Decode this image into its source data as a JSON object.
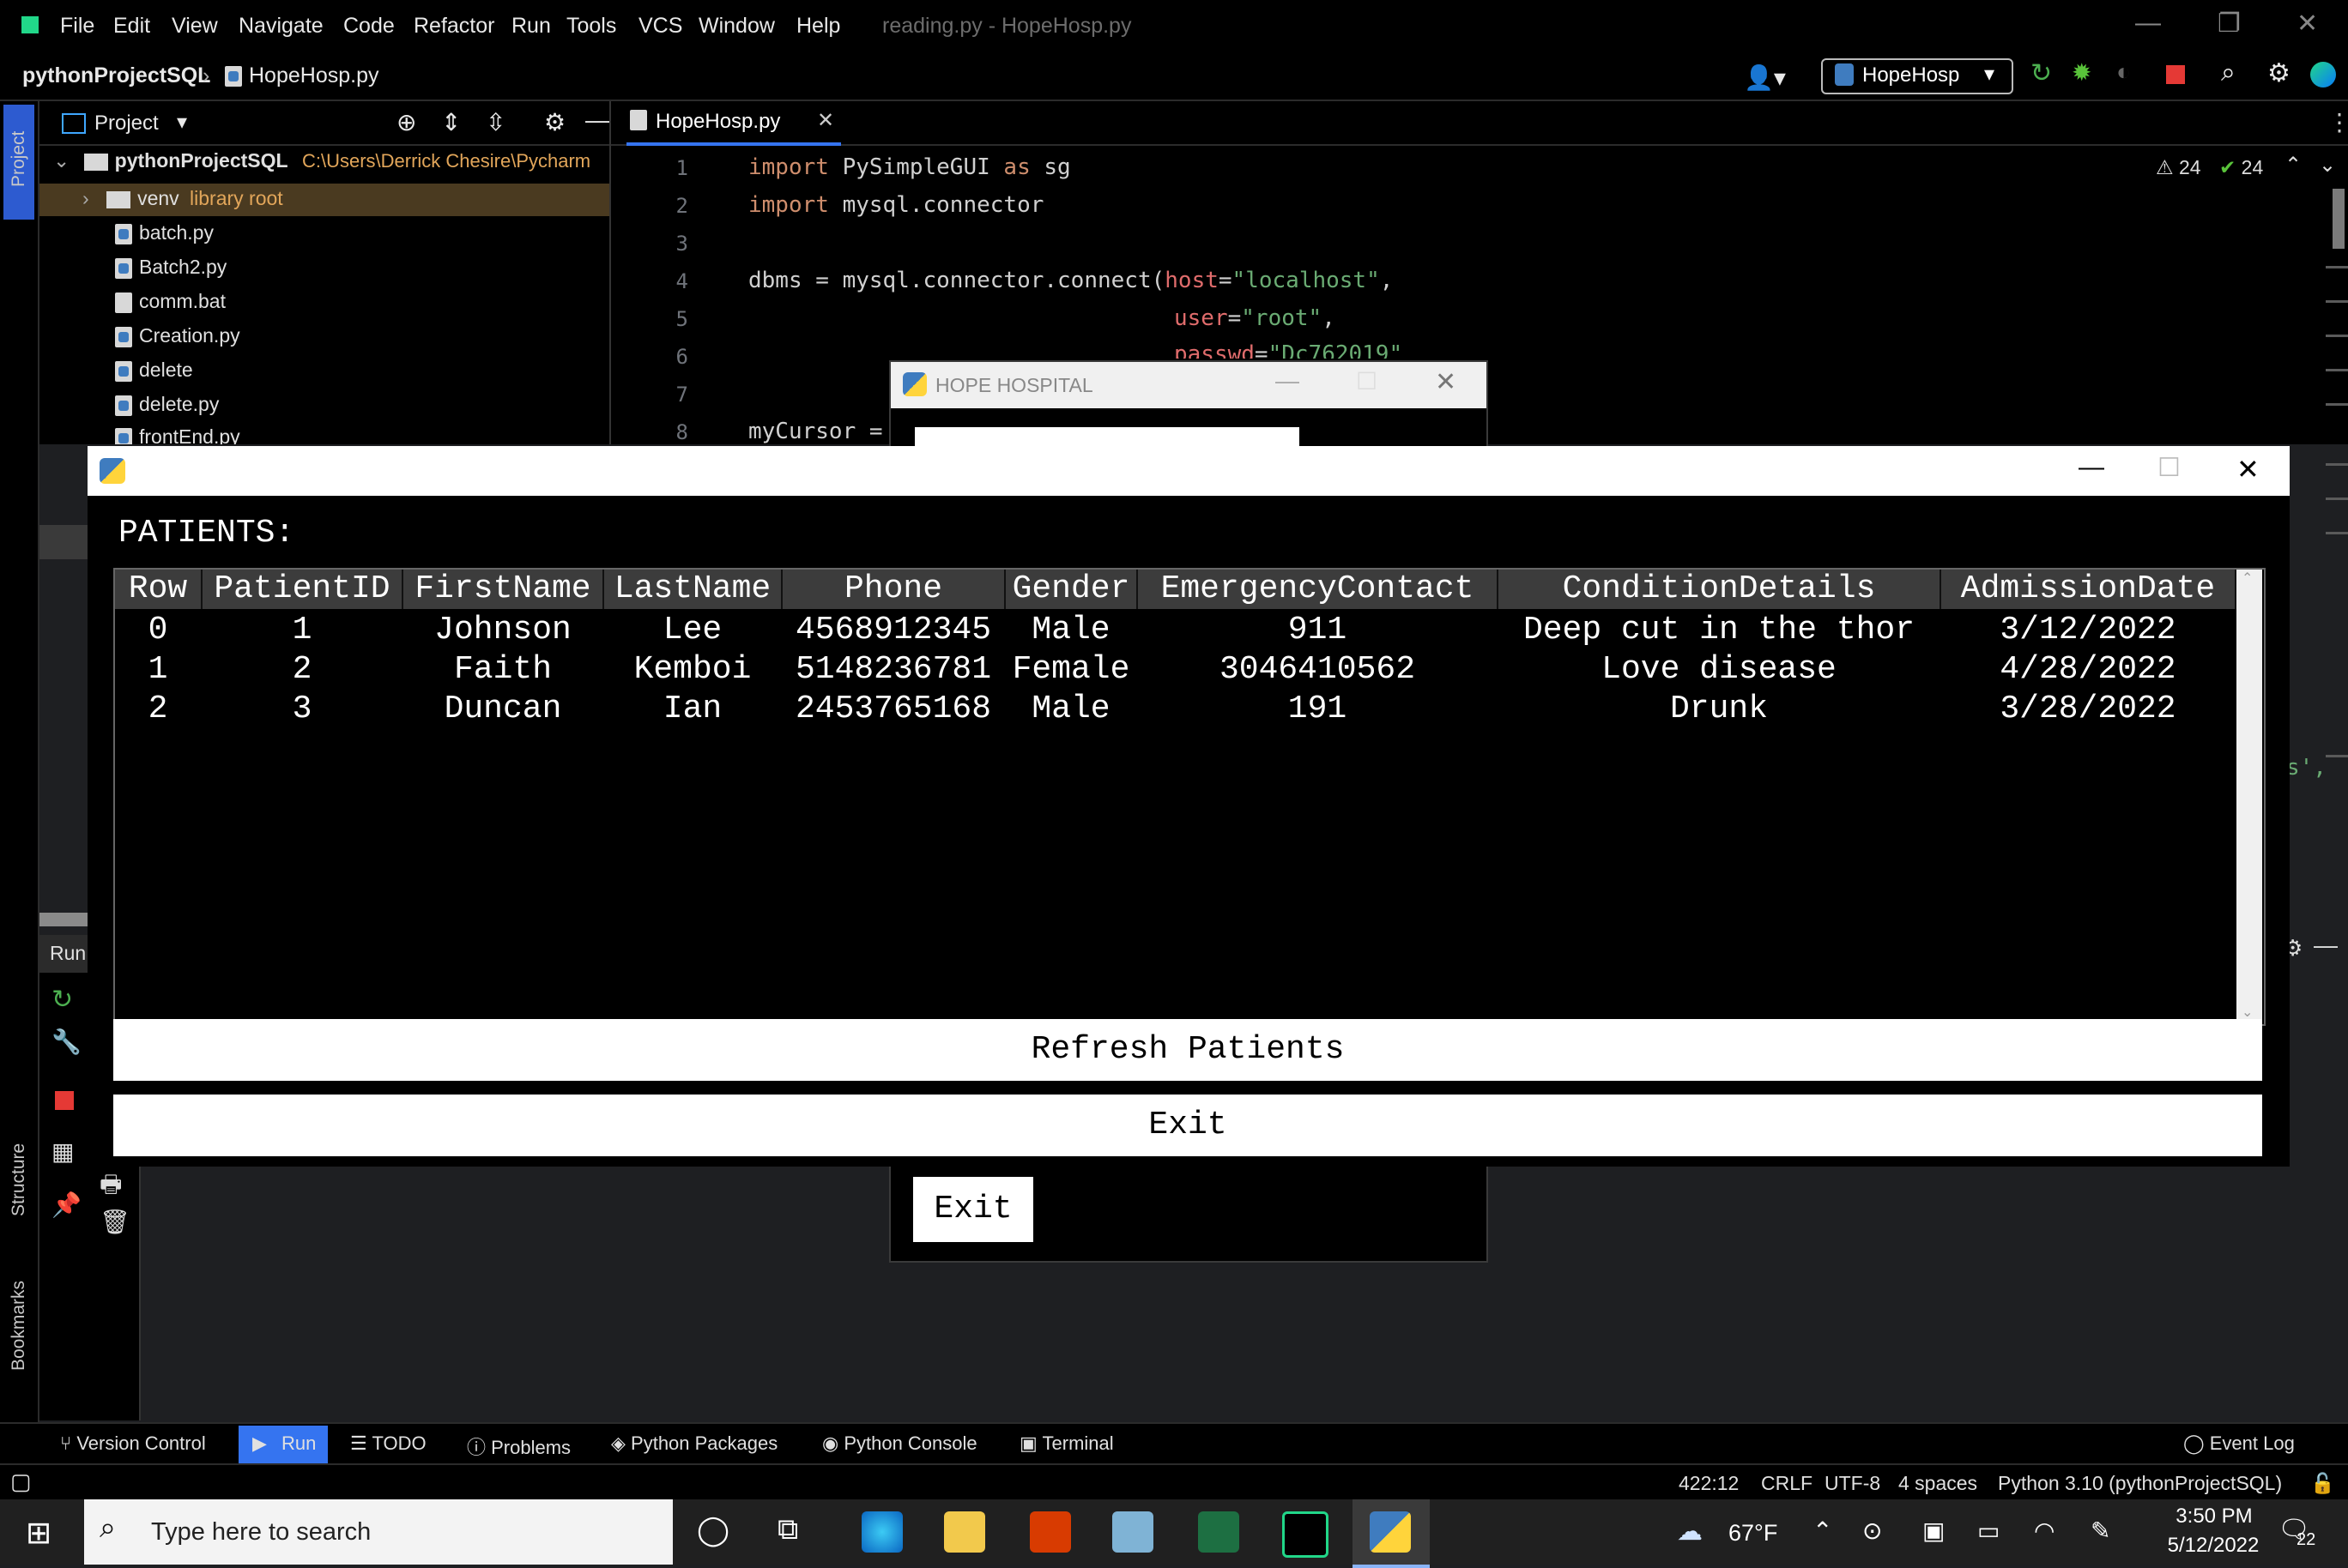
{
  "titlebar": {
    "menus": [
      "File",
      "Edit",
      "View",
      "Navigate",
      "Code",
      "Refactor",
      "Run",
      "Tools",
      "VCS",
      "Window",
      "Help"
    ],
    "window_title": "reading.py - HopeHosp.py"
  },
  "navbar": {
    "project": "pythonProjectSQL",
    "file": "HopeHosp.py",
    "run_config": "HopeHosp"
  },
  "project_panel": {
    "header": "Project",
    "root_name": "pythonProjectSQL",
    "root_path": "C:\\Users\\Derrick Chesire\\Pycharm",
    "venv_name": "venv",
    "venv_note": "library root",
    "files": [
      "batch.py",
      "Batch2.py",
      "comm.bat",
      "Creation.py",
      "delete",
      "delete.py",
      "frontEnd.py"
    ]
  },
  "editor": {
    "tab": "HopeHosp.py",
    "warnings": "24",
    "checks": "24",
    "line_numbers": [
      "1",
      "2",
      "3",
      "4",
      "5",
      "6",
      "7",
      "8"
    ],
    "lines": {
      "l1_kw": "import",
      "l1_rest": " PySimpleGUI ",
      "l1_as": "as",
      "l1_sg": " sg",
      "l2_kw": "import",
      "l2_rest": " mysql.connector",
      "l4_a": "dbms = mysql.connector.connect(",
      "l4_p": "host",
      "l4_eq": "=",
      "l4_s": "\"localhost\"",
      "l4_c": ",",
      "l5_p": "user",
      "l5_eq": "=",
      "l5_s": "\"root\"",
      "l5_c": ",",
      "l6_p": "passwd",
      "l6_eq": "=",
      "l6_s": "\"Dc762019\"",
      "l8": "myCursor ="
    },
    "right_fragment": "s',"
  },
  "run_panel": {
    "label": "Run:"
  },
  "side_labels": {
    "project": "Project",
    "structure": "Structure",
    "bookmarks": "Bookmarks"
  },
  "hope_window": {
    "title": "HOPE HOSPITAL",
    "exit_label": "Exit"
  },
  "patients_window": {
    "heading": "PATIENTS:",
    "columns": [
      "Row",
      "PatientID",
      "FirstName",
      "LastName",
      "Phone",
      "Gender",
      "EmergencyContact",
      "ConditionDetails",
      "AdmissionDate"
    ],
    "rows": [
      [
        "0",
        "1",
        "Johnson",
        "Lee",
        "4568912345",
        "Male",
        "911",
        "Deep cut in the thor",
        "3/12/2022"
      ],
      [
        "1",
        "2",
        "Faith",
        "Kemboi",
        "5148236781",
        "Female",
        "3046410562",
        "Love disease",
        "4/28/2022"
      ],
      [
        "2",
        "3",
        "Duncan",
        "Ian",
        "2453765168",
        "Male",
        "191",
        "Drunk",
        "3/28/2022"
      ]
    ],
    "refresh_label": "Refresh Patients",
    "exit_label": "Exit"
  },
  "bottom_tools": {
    "version_control": "Version Control",
    "run": "Run",
    "todo": "TODO",
    "problems": "Problems",
    "python_packages": "Python Packages",
    "python_console": "Python Console",
    "terminal": "Terminal",
    "event_log": "Event Log"
  },
  "statusbar": {
    "position": "422:12",
    "line_sep": "CRLF",
    "encoding": "UTF-8",
    "indent": "4 spaces",
    "interpreter": "Python 3.10 (pythonProjectSQL)"
  },
  "taskbar": {
    "search_placeholder": "Type here to search",
    "weather": "67°F",
    "time": "3:50 PM",
    "date": "5/12/2022",
    "notifications": "22"
  },
  "colors": {
    "ide_bg": "#000000",
    "keyword": "#cf8e6d",
    "string": "#6aab73",
    "param": "#e06c6c",
    "run_highlight": "#3574f0",
    "header_gray": "#3c3c3c"
  }
}
